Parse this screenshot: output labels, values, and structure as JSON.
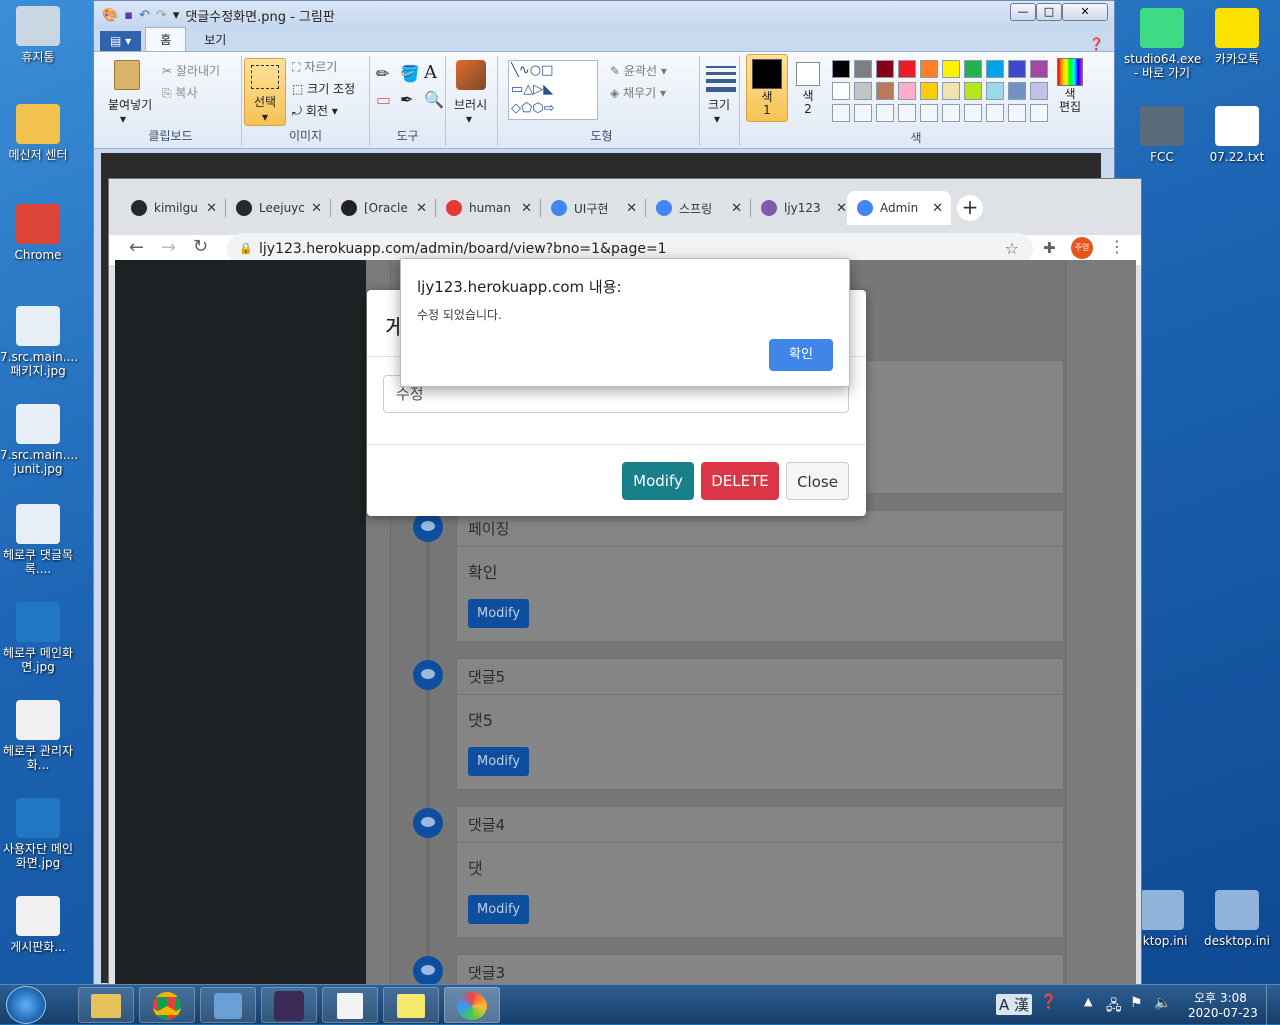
{
  "desktop": {
    "icons": [
      {
        "label": "휴지통",
        "color": "#c9d6e3"
      },
      {
        "label": "메신저 센터",
        "color": "#f2c14e"
      },
      {
        "label": "Chrome",
        "color": "#db4437"
      },
      {
        "label": "7.src.main.... 패키지.jpg",
        "color": "#e8eef5"
      },
      {
        "label": "7.src.main.... junit.jpg",
        "color": "#e8eef5"
      },
      {
        "label": "헤로쿠 댓글목록....",
        "color": "#e8eef5"
      },
      {
        "label": "헤로쿠 메인화면.jpg",
        "color": "#1f78c1"
      },
      {
        "label": "헤로쿠 관리자화...",
        "color": "#f0f0f0"
      },
      {
        "label": "사용자단 메인화면.jpg",
        "color": "#1f78c1"
      },
      {
        "label": "게시판화...",
        "color": "#f0f0f0"
      }
    ],
    "right_icons": [
      {
        "label": "studio64.exe - 바로 가기",
        "color": "#3ddc84"
      },
      {
        "label": "카카오톡",
        "color": "#fae100"
      },
      {
        "label": "FCC",
        "color": "#5a6b7a"
      },
      {
        "label": "07.22.txt",
        "color": "#ffffff"
      },
      {
        "label": "sktop.ini",
        "color": "#8fb3d9"
      },
      {
        "label": "desktop.ini",
        "color": "#8fb3d9"
      }
    ],
    "left_edge_chars": [
      "사",
      "댓",
      "헤",
      "댓",
      "화",
      "게",
      "화",
      "게"
    ]
  },
  "paint": {
    "title": "댓글수정화면.png - 그림판",
    "tabs": [
      "홈",
      "보기"
    ],
    "clipboard": {
      "paste": "붙여넣기",
      "cut": "잘라내기",
      "copy": "복사",
      "label": "클립보드"
    },
    "image": {
      "select": "선택",
      "crop": "자르기",
      "resize": "크기 조정",
      "rotate": "회전",
      "label": "이미지"
    },
    "tools_label": "도구",
    "brush": "브러시",
    "shapes": {
      "outline": "윤곽선",
      "fill": "채우기",
      "label": "도형"
    },
    "size": "크기",
    "color1": "색\n1",
    "color2": "색\n2",
    "edit_colors": "색\n편집",
    "colors_label": "색",
    "palette": [
      "#000000",
      "#7f7f7f",
      "#880015",
      "#ed1c24",
      "#ff7f27",
      "#fff200",
      "#22b14c",
      "#00a2e8",
      "#3f48cc",
      "#a349a4",
      "#ffffff",
      "#c3c3c3",
      "#b97a57",
      "#ffaec9",
      "#ffc90e",
      "#efe4b0",
      "#b5e61d",
      "#99d9ea",
      "#7092be",
      "#c8bfe7"
    ]
  },
  "chrome": {
    "tabs": [
      {
        "title": "kimilgu",
        "fav": "#24292e"
      },
      {
        "title": "Leejuyc",
        "fav": "#24292e"
      },
      {
        "title": "[Oracle",
        "fav": "#222222"
      },
      {
        "title": "human",
        "fav": "#e53935"
      },
      {
        "title": "UI구현",
        "fav": "#4285f4"
      },
      {
        "title": "스프링",
        "fav": "#4285f4"
      },
      {
        "title": "ljy123",
        "fav": "#7b5ea7"
      },
      {
        "title": "Admin",
        "fav": "#4285f4"
      }
    ],
    "url": "ljy123.herokuapp.com/admin/board/view?bno=1&page=1",
    "profile": "주영"
  },
  "page": {
    "comments": [
      {
        "writer": "페이징",
        "text": "확인",
        "button": "Modify"
      },
      {
        "writer": "댓글5",
        "text": "댓5",
        "button": "Modify"
      },
      {
        "writer": "댓글4",
        "text": "댓",
        "button": "Modify"
      },
      {
        "writer": "댓글3",
        "text": "",
        "button": ""
      }
    ],
    "modal": {
      "title_fragment": "게",
      "input_value": "수정",
      "modify": "Modify",
      "delete": "DELETE",
      "close": "Close"
    }
  },
  "alert": {
    "title": "ljy123.herokuapp.com 내용:",
    "message": "수정 되었습니다.",
    "ok": "확인"
  },
  "taskbar": {
    "ime": "A 漢",
    "time": "오후 3:08",
    "date": "2020-07-23"
  }
}
